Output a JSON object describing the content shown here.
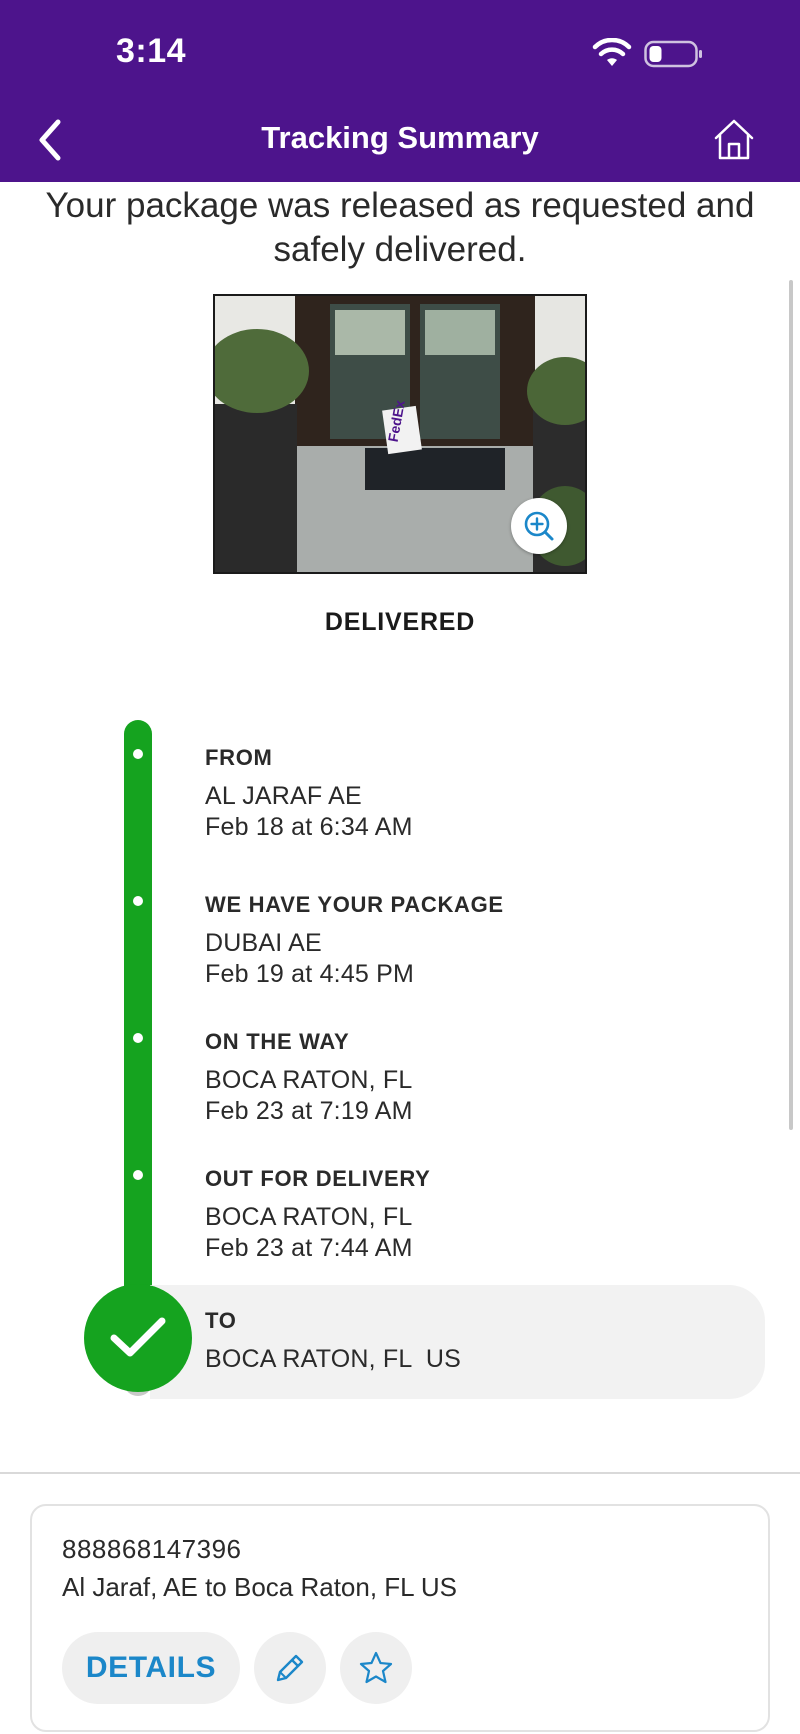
{
  "status_bar": {
    "time": "3:14"
  },
  "nav": {
    "title": "Tracking Summary",
    "back_icon": "chevron-left-icon",
    "home_icon": "home-icon"
  },
  "message": "Your package was released as requested and safely delivered.",
  "photo": {
    "brand_text": "FedEx",
    "zoom_icon": "zoom-in-icon"
  },
  "delivery_status": "DELIVERED",
  "timeline": {
    "color": "#15a31f",
    "events": [
      {
        "title": "FROM",
        "location": "AL JARAF AE",
        "time": "Feb 18 at 6:34 AM"
      },
      {
        "title": "WE HAVE YOUR PACKAGE",
        "location": "DUBAI AE",
        "time": "Feb 19 at 4:45 PM"
      },
      {
        "title": "ON THE WAY",
        "location": "BOCA RATON, FL",
        "time": "Feb 23 at 7:19 AM"
      },
      {
        "title": "OUT FOR DELIVERY",
        "location": "BOCA RATON, FL",
        "time": "Feb 23 at 7:44 AM"
      },
      {
        "title": "TO",
        "location": "BOCA RATON, FL  US"
      }
    ]
  },
  "card": {
    "tracking_number": "888868147396",
    "route": "Al Jaraf, AE to Boca Raton, FL US",
    "details_label": "DETAILS",
    "edit_icon": "pencil-icon",
    "star_icon": "star-icon"
  },
  "colors": {
    "header": "#4d148c",
    "accent": "#1b87c9",
    "success": "#15a31f"
  }
}
